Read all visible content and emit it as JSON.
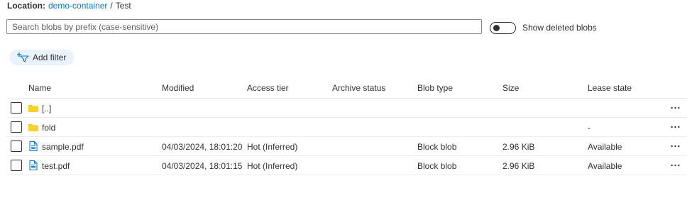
{
  "location": {
    "label": "Location:",
    "container": "demo-container",
    "separator": "/",
    "folder": "Test"
  },
  "search": {
    "placeholder": "Search blobs by prefix (case-sensitive)",
    "value": ""
  },
  "toggle": {
    "label": "Show deleted blobs",
    "state": "off"
  },
  "add_filter": {
    "label": "Add filter",
    "icon": "add-filter-icon"
  },
  "table": {
    "columns": [
      "Name",
      "Modified",
      "Access tier",
      "Archive status",
      "Blob type",
      "Size",
      "Lease state"
    ],
    "rows": [
      {
        "icon": "folder-icon",
        "name": "[..]",
        "modified": "",
        "access_tier": "",
        "archive_status": "",
        "blob_type": "",
        "size": "",
        "lease_state": "",
        "more": "..."
      },
      {
        "icon": "folder-icon",
        "name": "fold",
        "modified": "",
        "access_tier": "",
        "archive_status": "",
        "blob_type": "",
        "size": "",
        "lease_state": "-",
        "more": "..."
      },
      {
        "icon": "file-icon",
        "name": "sample.pdf",
        "modified": "04/03/2024, 18:01:20",
        "access_tier": "Hot (Inferred)",
        "archive_status": "",
        "blob_type": "Block blob",
        "size": "2.96 KiB",
        "lease_state": "Available",
        "more": "..."
      },
      {
        "icon": "file-icon",
        "name": "test.pdf",
        "modified": "04/03/2024, 18:01:15",
        "access_tier": "Hot (Inferred)",
        "archive_status": "",
        "blob_type": "Block blob",
        "size": "2.96 KiB",
        "lease_state": "Available",
        "more": "..."
      }
    ]
  },
  "colors": {
    "link": "#0078d4",
    "folder": "#f2c811",
    "file": "#0078d4",
    "filter_bg": "#eaf3fb"
  }
}
